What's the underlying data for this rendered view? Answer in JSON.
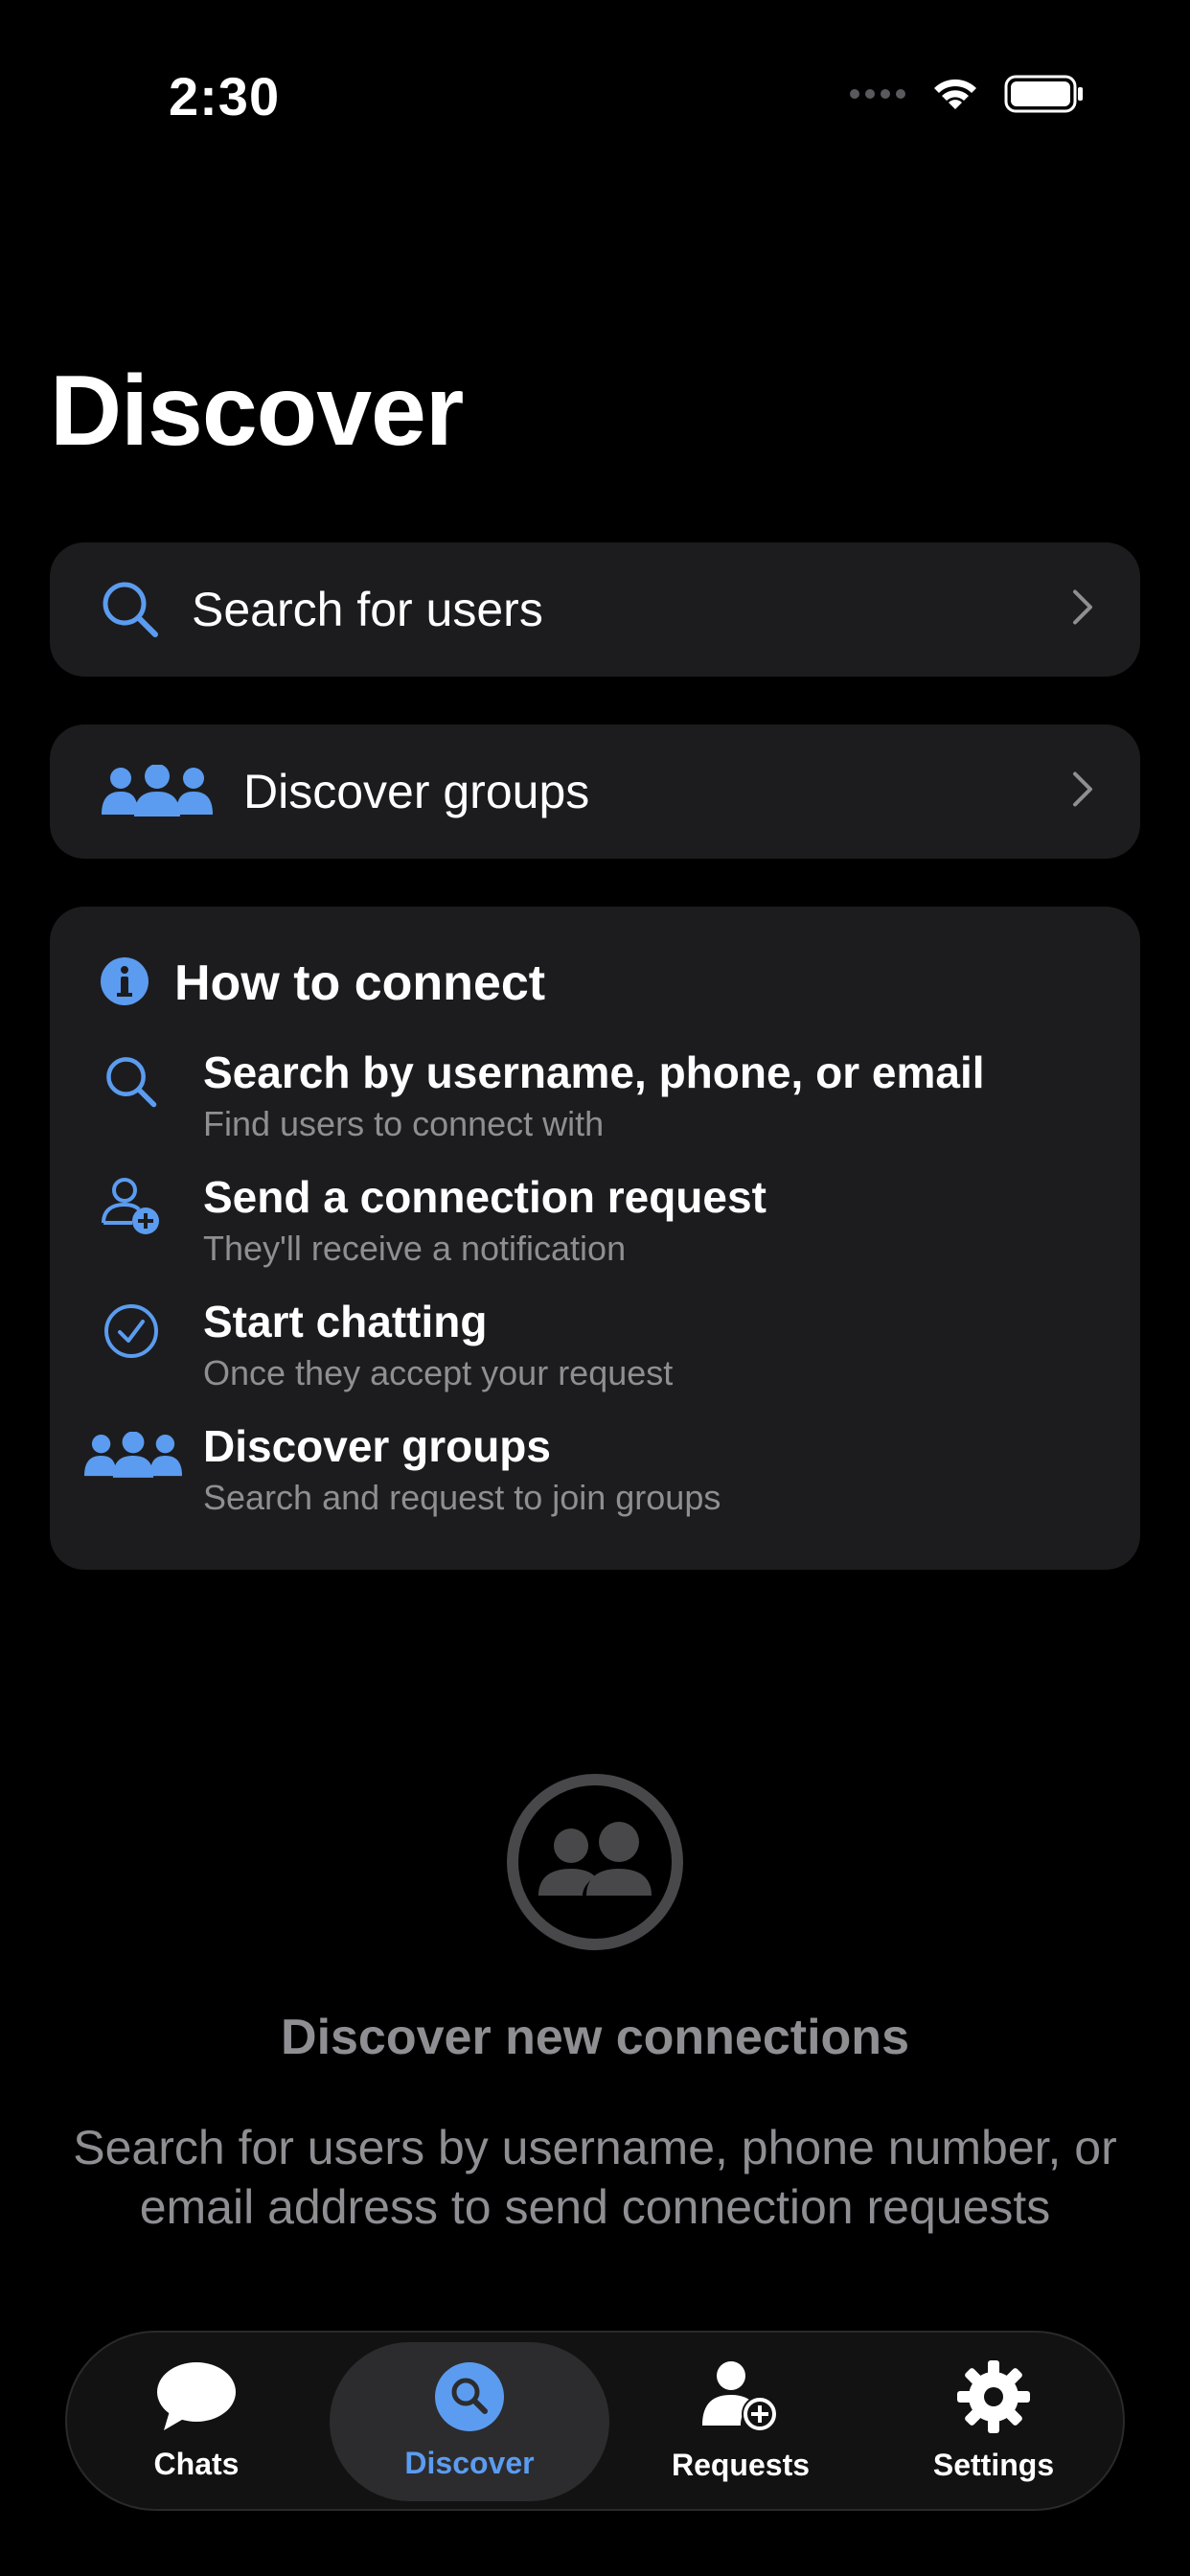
{
  "status": {
    "time": "2:30"
  },
  "page": {
    "title": "Discover"
  },
  "rows": {
    "search": {
      "label": "Search for users"
    },
    "groups": {
      "label": "Discover groups"
    }
  },
  "how_to": {
    "title": "How to connect",
    "steps": [
      {
        "icon": "search-icon",
        "title": "Search by username, phone, or email",
        "subtitle": "Find users to connect with"
      },
      {
        "icon": "person-add-icon",
        "title": "Send a connection request",
        "subtitle": "They'll receive a notification"
      },
      {
        "icon": "checkmark-circle-icon",
        "title": "Start chatting",
        "subtitle": "Once they accept your request"
      },
      {
        "icon": "groups-icon",
        "title": "Discover groups",
        "subtitle": "Search and request to join groups"
      }
    ]
  },
  "empty_state": {
    "title": "Discover new connections",
    "description": "Search for users by username, phone number, or email address to send connection requests"
  },
  "tabs": [
    {
      "label": "Chats",
      "icon": "chat-bubble-icon",
      "active": false
    },
    {
      "label": "Discover",
      "icon": "search-icon",
      "active": true
    },
    {
      "label": "Requests",
      "icon": "person-add-icon",
      "active": false
    },
    {
      "label": "Settings",
      "icon": "gear-icon",
      "active": false
    }
  ],
  "colors": {
    "accent": "#5b9cf0",
    "card": "#1c1c1e",
    "secondary_text": "#8e8e93"
  }
}
